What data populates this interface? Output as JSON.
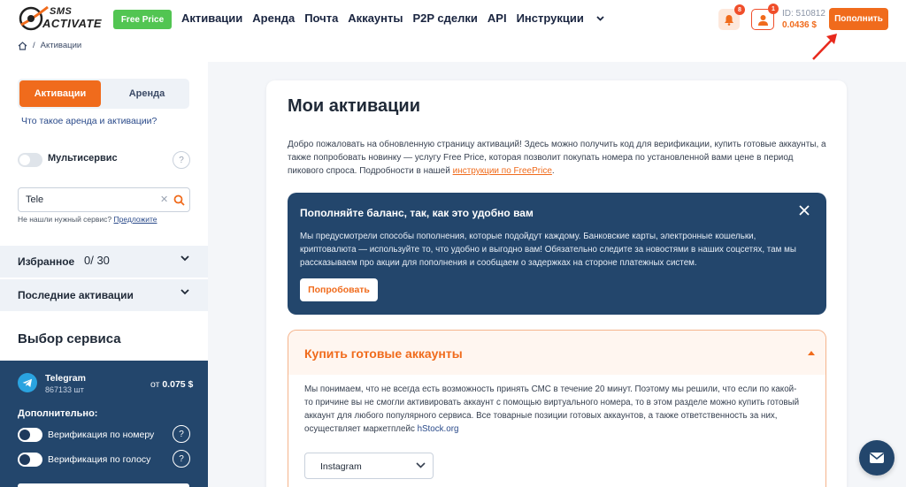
{
  "brand": {
    "line1": "SMS",
    "line2": "ACTIVATE"
  },
  "header": {
    "free_price": "Free Price",
    "nav": [
      "Активации",
      "Аренда",
      "Почта",
      "Аккаунты",
      "P2P сделки",
      "API",
      "Инструкции"
    ],
    "notif_count": "8",
    "user_badge": "1",
    "account_id": "ID: 510812",
    "balance": "0.0436 $",
    "topup": "Пополнить"
  },
  "breadcrumb": {
    "current": "Активации",
    "sep": "/"
  },
  "sidebar": {
    "tab_active": "Активации",
    "tab_other": "Аренда",
    "what_is": "Что такое аренда и активации?",
    "multiservice": "Мультисервис",
    "search_value": "Tele",
    "no_service": "Не нашли нужный сервис?",
    "suggest": "Предложите",
    "favorites": "Избранное",
    "favorites_count": "0/ 30",
    "recent": "Последние активации",
    "choose_service": "Выбор сервиса",
    "service": {
      "name": "Telegram",
      "count": "867133 шт",
      "price_prefix": "от",
      "price": "0.075 $"
    },
    "extra": "Дополнительно:",
    "opt_number": "Верификация по номеру",
    "opt_voice": "Верификация по голосу",
    "help": "?"
  },
  "main": {
    "title": "Мои активации",
    "intro": "Добро пожаловать на обновленную страницу активаций! Здесь можно получить код для верификации, купить готовые аккаунты, а также попробовать новинку — услугу Free Price, которая позволит покупать номера по установленной вами цене в период пикового спроса. Подробности в нашей ",
    "intro_link": "инструкции по FreePrice",
    "intro_end": ".",
    "promo": {
      "title": "Пополняйте баланс, так, как это удобно вам",
      "text": "Мы предусмотрели способы пополнения, которые подойдут каждому. Банковские карты, электронные кошельки, криптовалюта — используйте то, что удобно и выгодно вам! Обязательно следите за новостями в наших соцсетях, там мы рассказываем про акции для пополнения и сообщаем о задержках на стороне платежных систем.",
      "button": "Попробовать"
    },
    "buy": {
      "title": "Купить готовые аккаунты",
      "text": "Мы понимаем, что не всегда есть возможность принять СМС в течение 20 минут. Поэтому мы решили, что если по какой-то причине вы не смогли активировать аккаунт с помощью виртуального номера, то в этом разделе можно купить готовый аккаунт для любого популярного сервиса. Все товарные позиции готовых аккаунтов, а также ответственность за них, осуществляет маркетплейс ",
      "link": "hStock.org",
      "select": "Instagram"
    }
  },
  "colors": {
    "accent": "#f06b1c",
    "navy": "#23466c",
    "green": "#52c552"
  }
}
